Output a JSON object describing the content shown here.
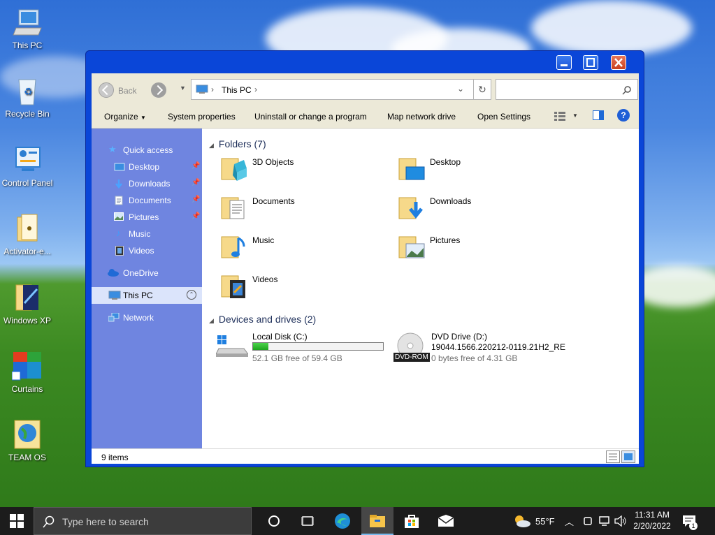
{
  "desktop": {
    "icons": [
      {
        "label": "This PC",
        "icon": "computer-icon"
      },
      {
        "label": "Recycle Bin",
        "icon": "recycle-bin-icon"
      },
      {
        "label": "Control Panel",
        "icon": "control-panel-icon"
      },
      {
        "label": "Activator-e...",
        "icon": "folder-icon"
      },
      {
        "label": "Windows XP",
        "icon": "folder-icon"
      },
      {
        "label": "Curtains",
        "icon": "curtains-icon"
      },
      {
        "label": "TEAM OS",
        "icon": "globe-icon"
      }
    ]
  },
  "window": {
    "nav": {
      "back_label": "Back"
    },
    "address": {
      "location": "This PC",
      "separator": "›"
    },
    "search": {
      "placeholder": ""
    },
    "commands": {
      "organize": "Organize",
      "system_properties": "System properties",
      "uninstall": "Uninstall or change a program",
      "map_drive": "Map network drive",
      "open_settings": "Open Settings"
    },
    "sidebar": {
      "quick_access": "Quick access",
      "items": [
        {
          "label": "Desktop",
          "pinned": true
        },
        {
          "label": "Downloads",
          "pinned": true
        },
        {
          "label": "Documents",
          "pinned": true
        },
        {
          "label": "Pictures",
          "pinned": true
        },
        {
          "label": "Music",
          "pinned": false
        },
        {
          "label": "Videos",
          "pinned": false
        }
      ],
      "onedrive": "OneDrive",
      "this_pc": "This PC",
      "network": "Network"
    },
    "folders_header": "Folders (7)",
    "folders": [
      {
        "name": "3D Objects"
      },
      {
        "name": "Desktop"
      },
      {
        "name": "Documents"
      },
      {
        "name": "Downloads"
      },
      {
        "name": "Music"
      },
      {
        "name": "Pictures"
      },
      {
        "name": "Videos"
      }
    ],
    "drives_header": "Devices and drives (2)",
    "drives": [
      {
        "name": "Local Disk (C:)",
        "free": "52.1 GB free of 59.4 GB",
        "used_fraction": 0.12
      },
      {
        "name": "DVD Drive (D:)",
        "label": "19044.1566.220212-0119.21H2_RE",
        "free": "0 bytes free of 4.31 GB",
        "badge": "DVD-ROM"
      }
    ],
    "status": {
      "items": "9 items"
    }
  },
  "taskbar": {
    "search_placeholder": "Type here to search",
    "weather": "55°F",
    "time": "11:31 AM",
    "date": "2/20/2022",
    "notification_count": "1"
  },
  "colors": {
    "window_blue": "#0a46d8",
    "nav_pane": "#6f85e0",
    "taskbar": "#1c1c1c"
  }
}
